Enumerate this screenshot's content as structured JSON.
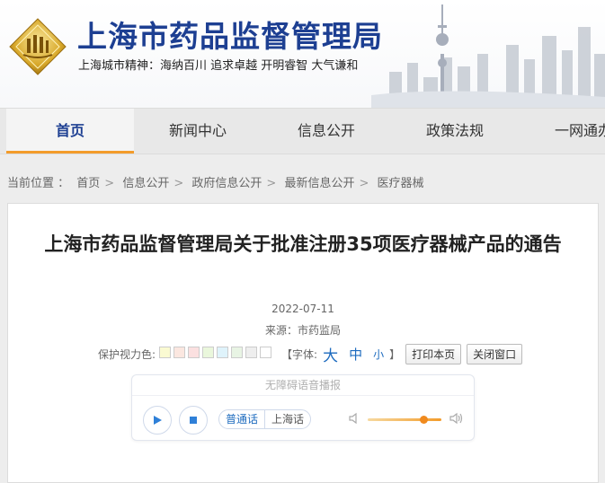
{
  "header": {
    "site_title": "上海市药品监督管理局",
    "slogan": "上海城市精神：海纳百川  追求卓越  开明睿智  大气谦和"
  },
  "nav": {
    "items": [
      {
        "label": "首页"
      },
      {
        "label": "新闻中心"
      },
      {
        "label": "信息公开"
      },
      {
        "label": "政策法规"
      },
      {
        "label": "一网通办"
      }
    ],
    "active_index": 0
  },
  "breadcrumb": {
    "prefix": "当前位置 ：",
    "items": [
      "首页",
      "信息公开",
      "政府信息公开",
      "最新信息公开",
      "医疗器械"
    ]
  },
  "article": {
    "title": "上海市药品监督管理局关于批准注册35项医疗器械产品的通告",
    "date": "2022-07-11",
    "source": "来源：市药监局"
  },
  "tools": {
    "color_label": "保护视力色:",
    "swatch_colors": [
      "#fafad2",
      "#fbe7e0",
      "#fbe0e0",
      "#eaf7dc",
      "#dff3fb",
      "#e8f4e4",
      "#eeeeee",
      "#ffffff"
    ],
    "font_label": "【字体:",
    "font_large": "大",
    "font_medium": "中",
    "font_small": "小",
    "font_close": "】",
    "print_label": "打印本页",
    "close_label": "关闭窗口"
  },
  "player": {
    "header_label": "无障碍语音播报",
    "lang_mandarin": "普通话",
    "lang_shanghai": "上海话",
    "volume_level": 0.8
  },
  "colors": {
    "brand_blue": "#1d3f92",
    "accent_orange": "#f39c2b"
  }
}
